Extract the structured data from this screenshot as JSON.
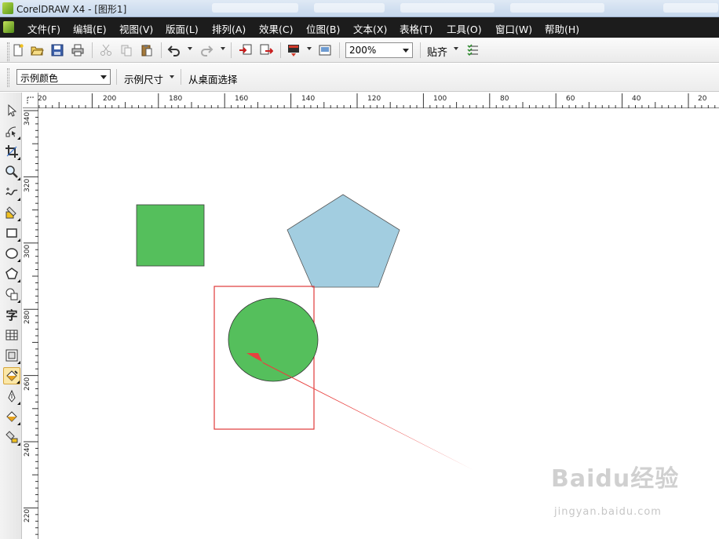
{
  "window": {
    "title": "CorelDRAW X4 - [图形1]"
  },
  "menu": {
    "items": [
      "文件(F)",
      "编辑(E)",
      "视图(V)",
      "版面(L)",
      "排列(A)",
      "效果(C)",
      "位图(B)",
      "文本(X)",
      "表格(T)",
      "工具(O)",
      "窗口(W)",
      "帮助(H)"
    ]
  },
  "toolbar": {
    "zoom_value": "200%",
    "snap_label": "贴齐",
    "icons": [
      "new-icon",
      "open-icon",
      "save-icon",
      "print-icon",
      "cut-icon",
      "copy-icon",
      "paste-icon",
      "undo-icon",
      "redo-icon",
      "import-icon",
      "export-icon",
      "application-launcher-icon",
      "welcome-screen-icon",
      "options-icon"
    ]
  },
  "property_bar": {
    "sample_color": "示例颜色",
    "sample_size": "示例尺寸",
    "select_from_desktop": "从桌面选择"
  },
  "toolbox": {
    "tools": [
      "pick-tool-icon",
      "shape-tool-icon",
      "crop-tool-icon",
      "zoom-tool-icon",
      "freehand-tool-icon",
      "smart-fill-tool-icon",
      "rectangle-tool-icon",
      "ellipse-tool-icon",
      "polygon-tool-icon",
      "basic-shapes-tool-icon",
      "text-tool-icon",
      "table-tool-icon",
      "interactive-tool-icon",
      "eyedropper-tool-icon",
      "outline-tool-icon",
      "fill-tool-icon",
      "interactive-fill-tool-icon"
    ],
    "text_tool_glyph": "字",
    "active_tool": "eyedropper-tool-icon"
  },
  "rulers": {
    "horizontal_labels": [
      "20",
      "200",
      "180",
      "160",
      "140",
      "120",
      "100",
      "80",
      "60",
      "40",
      "20"
    ],
    "vertical_labels": [
      "340",
      "320",
      "300",
      "280",
      "260",
      "240",
      "220"
    ]
  },
  "canvas": {
    "shapes": [
      {
        "name": "green-square",
        "fill": "#55bf5c"
      },
      {
        "name": "blue-pentagon",
        "fill": "#a2cde0"
      },
      {
        "name": "green-circle",
        "fill": "#55bf5c"
      }
    ],
    "highlight_color": "#e03a3a",
    "arrow_color": "#e8413f"
  },
  "watermark": {
    "main": "Baidu经验",
    "sub": "jingyan.baidu.com"
  }
}
